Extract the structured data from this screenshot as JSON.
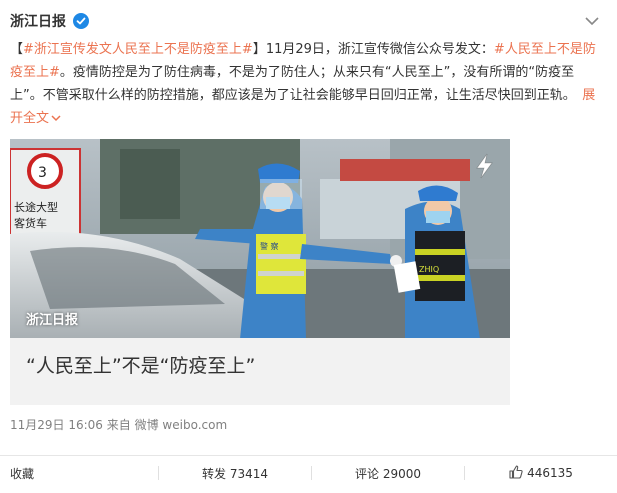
{
  "post": {
    "author": "浙江日报",
    "verified": true,
    "icons": {
      "verified": "verified-badge-icon",
      "menu": "chevron-down-icon",
      "expand": "chevron-down-icon",
      "video": "lightning-icon",
      "like": "thumbs-up-icon"
    },
    "text": {
      "bracket_open": "【",
      "topic1": "#浙江宣传发文人民至上不是防疫至上#",
      "bracket_close": "】",
      "body1": "11月29日，浙江宣传微信公众号发文：",
      "topic2": "#人民至上不是防疫至上#",
      "body2": "。疫情防控是为了防住病毒，不是为了防住人；从来只有“人民至上”，没有所谓的“防疫至上”。不管采取什么样的防控措施，都应该是为了让社会能够早日回归正常，让生活尽快回到正轨。",
      "expand": "展开全文"
    },
    "card": {
      "watermark": "浙江日报",
      "title": "“人民至上”不是“防疫至上”",
      "sign_lines": [
        "长途大型",
        "客货车"
      ],
      "vest_text_left": "警 察",
      "vest_text_right": "ZHIQ"
    },
    "meta": {
      "time": "11月29日 16:06",
      "from": "来自",
      "source": "微博 weibo.com"
    },
    "actions": {
      "collect": "收藏",
      "repost": "转发 73414",
      "comment": "评论 29000",
      "like": "446135"
    }
  }
}
